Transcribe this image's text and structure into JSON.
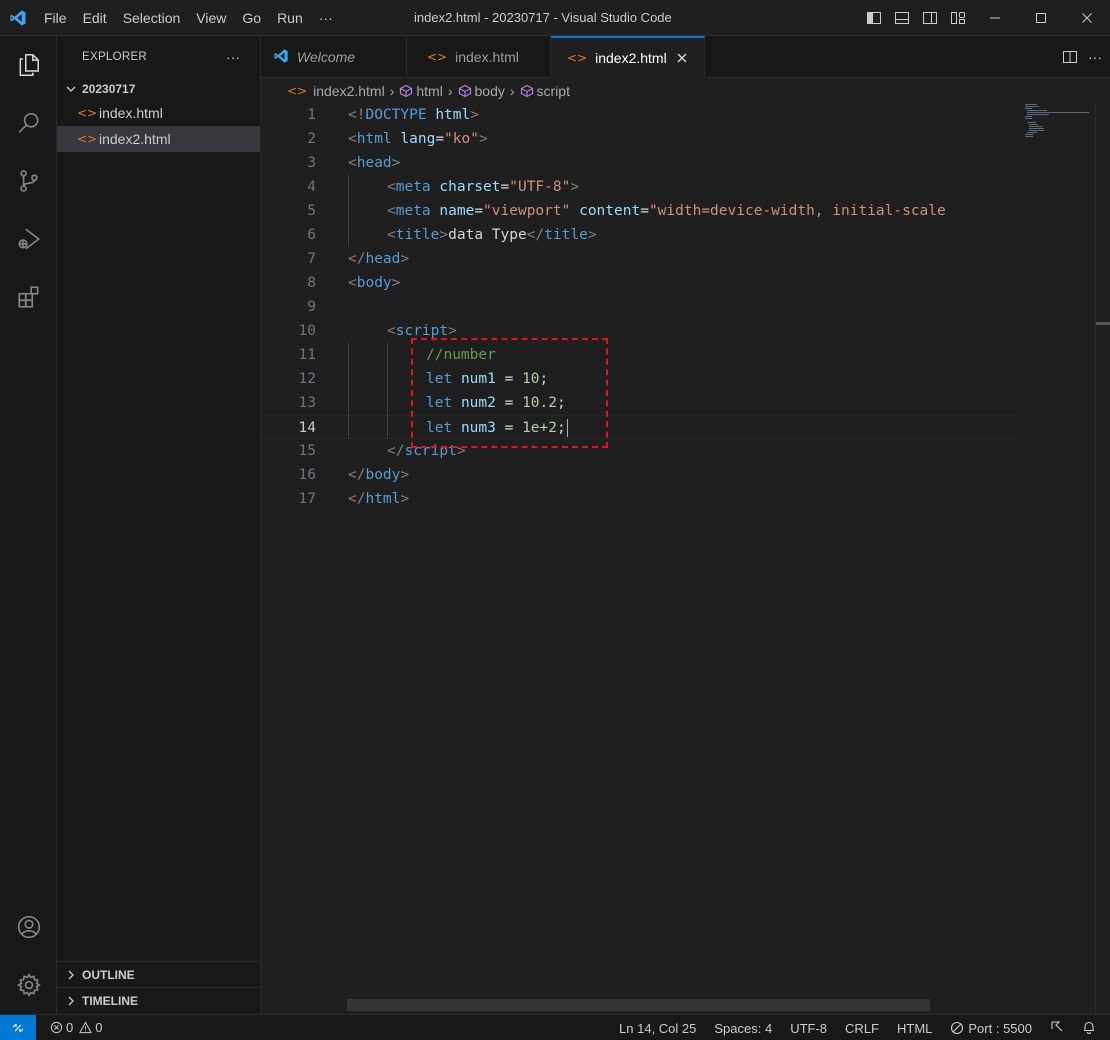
{
  "titlebar": {
    "menu": [
      "File",
      "Edit",
      "Selection",
      "View",
      "Go",
      "Run",
      "···"
    ],
    "window_title": "index2.html - 20230717 - Visual Studio Code"
  },
  "sidebar": {
    "title": "EXPLORER",
    "folder": "20230717",
    "files": [
      {
        "name": "index.html",
        "active": false
      },
      {
        "name": "index2.html",
        "active": true
      }
    ],
    "panels": [
      "OUTLINE",
      "TIMELINE"
    ]
  },
  "tabs": [
    {
      "label": "Welcome",
      "active": false
    },
    {
      "label": "index.html",
      "active": false
    },
    {
      "label": "index2.html",
      "active": true
    }
  ],
  "breadcrumb": [
    "index2.html",
    "html",
    "body",
    "script"
  ],
  "editor": {
    "current_line": 14,
    "lines": [
      {
        "n": 1,
        "indent": 0,
        "tokens": [
          [
            "br",
            "<!"
          ],
          [
            "tag",
            "DOCTYPE"
          ],
          [
            "txt",
            " "
          ],
          [
            "attr",
            "html"
          ],
          [
            "br",
            ">"
          ]
        ]
      },
      {
        "n": 2,
        "indent": 0,
        "tokens": [
          [
            "br",
            "<"
          ],
          [
            "tag",
            "html"
          ],
          [
            "txt",
            " "
          ],
          [
            "attr",
            "lang"
          ],
          [
            "txt",
            "="
          ],
          [
            "str",
            "\"ko\""
          ],
          [
            "br",
            ">"
          ]
        ]
      },
      {
        "n": 3,
        "indent": 0,
        "tokens": [
          [
            "br",
            "<"
          ],
          [
            "tag",
            "head"
          ],
          [
            "br",
            ">"
          ]
        ]
      },
      {
        "n": 4,
        "indent": 1,
        "tokens": [
          [
            "br",
            "<"
          ],
          [
            "tag",
            "meta"
          ],
          [
            "txt",
            " "
          ],
          [
            "attr",
            "charset"
          ],
          [
            "txt",
            "="
          ],
          [
            "str",
            "\"UTF-8\""
          ],
          [
            "br",
            ">"
          ]
        ]
      },
      {
        "n": 5,
        "indent": 1,
        "tokens": [
          [
            "br",
            "<"
          ],
          [
            "tag",
            "meta"
          ],
          [
            "txt",
            " "
          ],
          [
            "attr",
            "name"
          ],
          [
            "txt",
            "="
          ],
          [
            "str",
            "\"viewport\""
          ],
          [
            "txt",
            " "
          ],
          [
            "attr",
            "content"
          ],
          [
            "txt",
            "="
          ],
          [
            "str",
            "\"width=device-width, initial-scale"
          ]
        ]
      },
      {
        "n": 6,
        "indent": 1,
        "tokens": [
          [
            "br",
            "<"
          ],
          [
            "tag",
            "title"
          ],
          [
            "br",
            ">"
          ],
          [
            "txt",
            "data Type"
          ],
          [
            "br",
            "</"
          ],
          [
            "tag",
            "title"
          ],
          [
            "br",
            ">"
          ]
        ]
      },
      {
        "n": 7,
        "indent": 0,
        "tokens": [
          [
            "br",
            "</"
          ],
          [
            "tag",
            "head"
          ],
          [
            "br",
            ">"
          ]
        ]
      },
      {
        "n": 8,
        "indent": 0,
        "tokens": [
          [
            "br",
            "<"
          ],
          [
            "tag",
            "body"
          ],
          [
            "br",
            ">"
          ]
        ]
      },
      {
        "n": 9,
        "indent": 0,
        "tokens": []
      },
      {
        "n": 10,
        "indent": 1,
        "tokens": [
          [
            "br",
            "<"
          ],
          [
            "tag",
            "script"
          ],
          [
            "br",
            ">"
          ]
        ]
      },
      {
        "n": 11,
        "indent": 2,
        "tokens": [
          [
            "cm",
            "//number"
          ]
        ]
      },
      {
        "n": 12,
        "indent": 2,
        "tokens": [
          [
            "kw",
            "let"
          ],
          [
            "txt",
            " "
          ],
          [
            "var",
            "num1"
          ],
          [
            "op",
            " = "
          ],
          [
            "num",
            "10"
          ],
          [
            "op",
            ";"
          ]
        ]
      },
      {
        "n": 13,
        "indent": 2,
        "tokens": [
          [
            "kw",
            "let"
          ],
          [
            "txt",
            " "
          ],
          [
            "var",
            "num2"
          ],
          [
            "op",
            " = "
          ],
          [
            "num",
            "10.2"
          ],
          [
            "op",
            ";"
          ]
        ]
      },
      {
        "n": 14,
        "indent": 2,
        "tokens": [
          [
            "kw",
            "let"
          ],
          [
            "txt",
            " "
          ],
          [
            "var",
            "num3"
          ],
          [
            "op",
            " = "
          ],
          [
            "num",
            "1e+2"
          ],
          [
            "op",
            ";"
          ]
        ]
      },
      {
        "n": 15,
        "indent": 1,
        "tokens": [
          [
            "br",
            "</"
          ],
          [
            "tag",
            "script"
          ],
          [
            "br",
            ">"
          ]
        ]
      },
      {
        "n": 16,
        "indent": 0,
        "tokens": [
          [
            "br",
            "</"
          ],
          [
            "tag",
            "body"
          ],
          [
            "br",
            ">"
          ]
        ]
      },
      {
        "n": 17,
        "indent": 0,
        "tokens": [
          [
            "br",
            "</"
          ],
          [
            "tag",
            "html"
          ],
          [
            "br",
            ">"
          ]
        ]
      }
    ]
  },
  "statusbar": {
    "errors": "0",
    "warnings": "0",
    "position": "Ln 14, Col 25",
    "spaces": "Spaces: 4",
    "encoding": "UTF-8",
    "eol": "CRLF",
    "language": "HTML",
    "port": "Port : 5500"
  }
}
